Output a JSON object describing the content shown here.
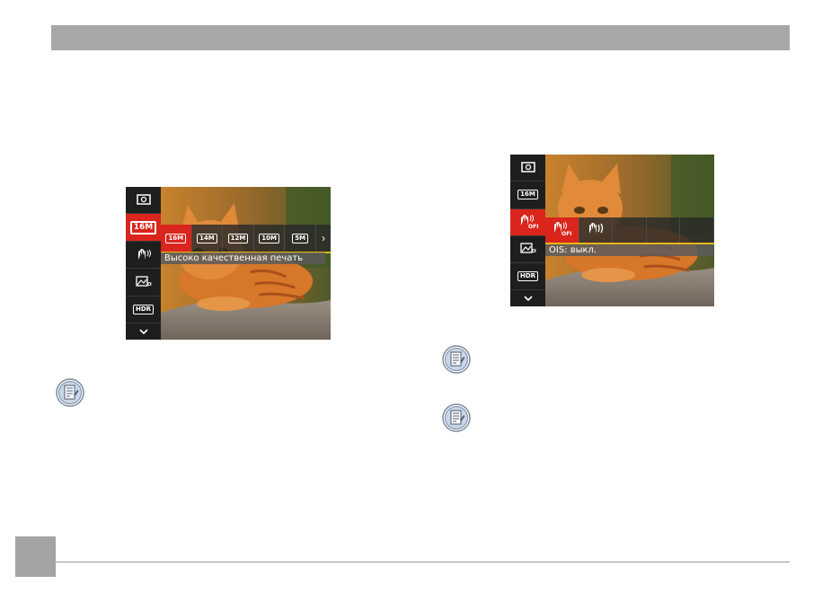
{
  "left_screen": {
    "side_menu": [
      {
        "icon": "metering-icon"
      },
      {
        "icon": "image-size-icon",
        "label": "16M"
      },
      {
        "icon": "ois-icon"
      },
      {
        "icon": "scene-icon"
      },
      {
        "icon": "hdr-icon",
        "label": "HDR"
      },
      {
        "icon": "chevron-down-icon"
      }
    ],
    "options": [
      "16M",
      "14M",
      "12M",
      "10M",
      "5M"
    ],
    "selected_option": "16M",
    "more_arrow": "›",
    "caption": "Высоко качественная печать"
  },
  "right_screen": {
    "side_menu": [
      {
        "icon": "metering-icon"
      },
      {
        "icon": "image-size-icon",
        "label": "16M"
      },
      {
        "icon": "ois-off-icon",
        "label": "OFF"
      },
      {
        "icon": "scene-icon"
      },
      {
        "icon": "hdr-icon",
        "label": "HDR"
      },
      {
        "icon": "chevron-down-icon"
      }
    ],
    "options": [
      {
        "icon": "ois-off-icon",
        "label": "OFF"
      },
      {
        "icon": "ois-on-icon"
      }
    ],
    "caption": "OIS: выкл."
  },
  "colors": {
    "header_bar": "#a7a7a7",
    "accent_red": "#d9251c",
    "underline_yellow": "#e7b51c"
  }
}
